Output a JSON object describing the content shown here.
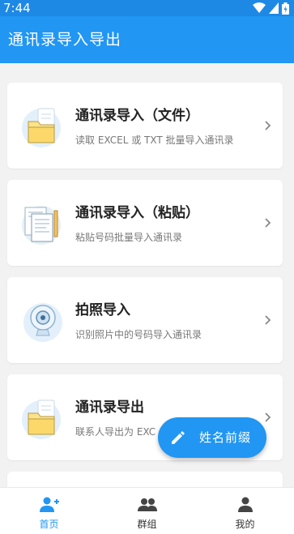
{
  "status_bar": {
    "time": "7:44",
    "icons": [
      "wifi-icon",
      "signal-icon",
      "battery-icon"
    ]
  },
  "app_bar": {
    "title": "通讯录导入导出"
  },
  "cards": [
    {
      "title": "通讯录导入（文件）",
      "subtitle": "读取 EXCEL 或 TXT 批量导入通讯录",
      "icon": "folder-icon"
    },
    {
      "title": "通讯录导入（粘贴）",
      "subtitle": "粘贴号码批量导入通讯录",
      "icon": "document-paste-icon"
    },
    {
      "title": "拍照导入",
      "subtitle": "识别照片中的号码导入通讯录",
      "icon": "camera-icon"
    },
    {
      "title": "通讯录导出",
      "subtitle": "联系人导出为 EXC",
      "icon": "folder-icon"
    }
  ],
  "fab": {
    "label": "姓名前缀",
    "icon": "pencil-icon"
  },
  "bottom_nav": [
    {
      "label": "首页",
      "icon": "person-add-icon",
      "active": true
    },
    {
      "label": "群组",
      "icon": "group-icon",
      "active": false
    },
    {
      "label": "我的",
      "icon": "person-icon",
      "active": false
    }
  ],
  "colors": {
    "primary": "#2196f3",
    "status_bar": "#1e88e5",
    "background": "#f2f2f2",
    "accent_yellow": "#fbe38a"
  }
}
